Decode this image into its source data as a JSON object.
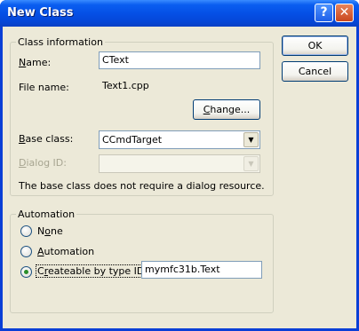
{
  "window": {
    "title": "New Class",
    "help_glyph": "?",
    "close_glyph": "✕"
  },
  "class_info": {
    "group_label": "Class information",
    "name_label": "Name:",
    "name_accel": "N",
    "name_rest": "ame:",
    "name_value": "CText",
    "file_name_label": "File name:",
    "file_name_value": "Text1.cpp",
    "change_button_accel": "C",
    "change_button_rest": "hange...",
    "base_class_accel": "B",
    "base_class_rest": "ase class:",
    "base_class_value": "CCmdTarget",
    "dialog_id_accel": "D",
    "dialog_id_rest": "ialog ID:",
    "dialog_id_value": "",
    "note": "The base class does not require a dialog resource."
  },
  "automation": {
    "group_label": "Automation",
    "options": [
      {
        "accel": "o",
        "pre": "N",
        "post": "ne",
        "checked": false
      },
      {
        "accel": "A",
        "pre": "",
        "post": "utomation",
        "checked": false
      },
      {
        "accel": "r",
        "pre": "C",
        "post": "eateable by type ID:",
        "checked": true
      }
    ],
    "type_id_value": "mymfc31b.Text"
  },
  "buttons": {
    "ok": "OK",
    "cancel": "Cancel"
  },
  "colors": {
    "titlebar": "#0550e6",
    "dialog_face": "#ece9d8",
    "input_border": "#7f9db9",
    "disabled_text": "#a7a591"
  },
  "icons": {
    "combo_arrow": "▼"
  }
}
